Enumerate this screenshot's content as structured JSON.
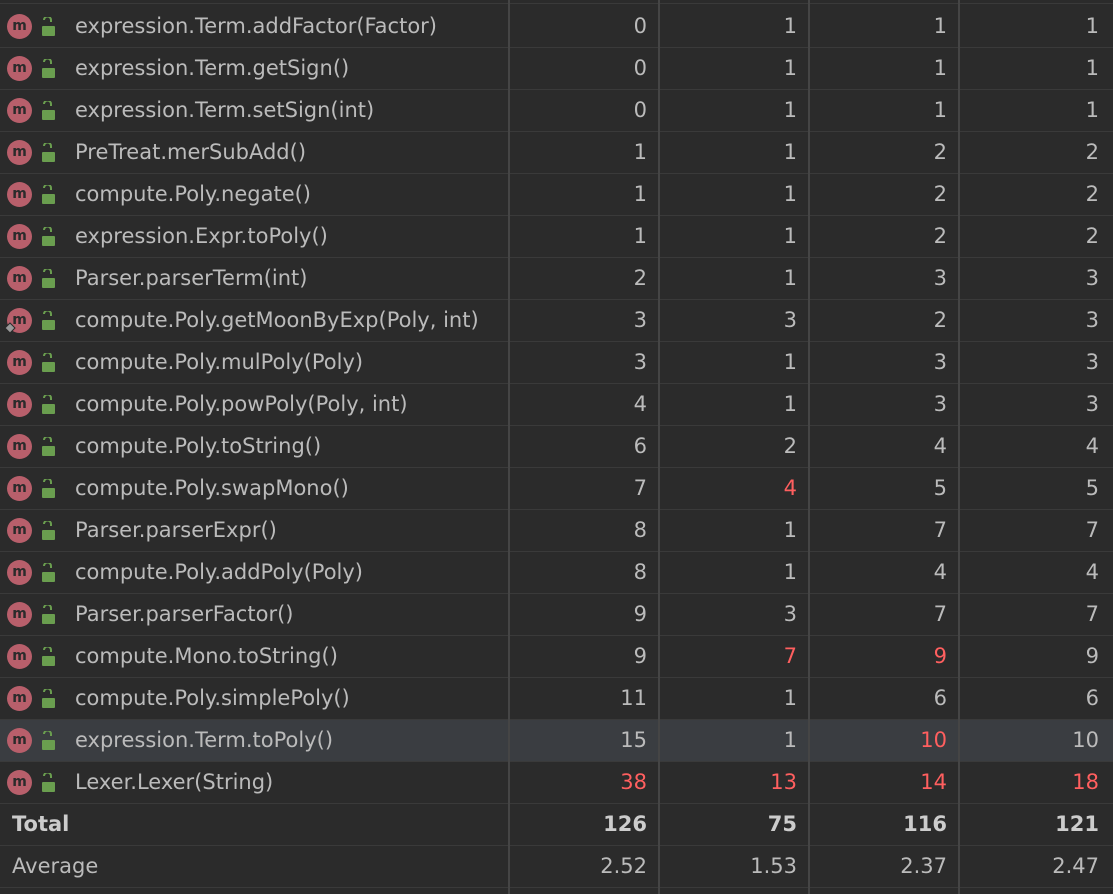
{
  "rows": [
    {
      "name": "expression.Term.addFactor(Factor)",
      "v": [
        "0",
        "1",
        "1",
        "1"
      ],
      "hot": [
        false,
        false,
        false,
        false
      ]
    },
    {
      "name": "expression.Term.getSign()",
      "v": [
        "0",
        "1",
        "1",
        "1"
      ],
      "hot": [
        false,
        false,
        false,
        false
      ]
    },
    {
      "name": "expression.Term.setSign(int)",
      "v": [
        "0",
        "1",
        "1",
        "1"
      ],
      "hot": [
        false,
        false,
        false,
        false
      ]
    },
    {
      "name": "PreTreat.merSubAdd()",
      "v": [
        "1",
        "1",
        "2",
        "2"
      ],
      "hot": [
        false,
        false,
        false,
        false
      ]
    },
    {
      "name": "compute.Poly.negate()",
      "v": [
        "1",
        "1",
        "2",
        "2"
      ],
      "hot": [
        false,
        false,
        false,
        false
      ]
    },
    {
      "name": "expression.Expr.toPoly()",
      "v": [
        "1",
        "1",
        "2",
        "2"
      ],
      "hot": [
        false,
        false,
        false,
        false
      ]
    },
    {
      "name": "Parser.parserTerm(int)",
      "v": [
        "2",
        "1",
        "3",
        "3"
      ],
      "hot": [
        false,
        false,
        false,
        false
      ]
    },
    {
      "name": "compute.Poly.getMoonByExp(Poly, int)",
      "v": [
        "3",
        "3",
        "2",
        "3"
      ],
      "hot": [
        false,
        false,
        false,
        false
      ],
      "override": true
    },
    {
      "name": "compute.Poly.mulPoly(Poly)",
      "v": [
        "3",
        "1",
        "3",
        "3"
      ],
      "hot": [
        false,
        false,
        false,
        false
      ]
    },
    {
      "name": "compute.Poly.powPoly(Poly, int)",
      "v": [
        "4",
        "1",
        "3",
        "3"
      ],
      "hot": [
        false,
        false,
        false,
        false
      ]
    },
    {
      "name": "compute.Poly.toString()",
      "v": [
        "6",
        "2",
        "4",
        "4"
      ],
      "hot": [
        false,
        false,
        false,
        false
      ]
    },
    {
      "name": "compute.Poly.swapMono()",
      "v": [
        "7",
        "4",
        "5",
        "5"
      ],
      "hot": [
        false,
        true,
        false,
        false
      ]
    },
    {
      "name": "Parser.parserExpr()",
      "v": [
        "8",
        "1",
        "7",
        "7"
      ],
      "hot": [
        false,
        false,
        false,
        false
      ]
    },
    {
      "name": "compute.Poly.addPoly(Poly)",
      "v": [
        "8",
        "1",
        "4",
        "4"
      ],
      "hot": [
        false,
        false,
        false,
        false
      ]
    },
    {
      "name": "Parser.parserFactor()",
      "v": [
        "9",
        "3",
        "7",
        "7"
      ],
      "hot": [
        false,
        false,
        false,
        false
      ]
    },
    {
      "name": "compute.Mono.toString()",
      "v": [
        "9",
        "7",
        "9",
        "9"
      ],
      "hot": [
        false,
        true,
        true,
        false
      ]
    },
    {
      "name": "compute.Poly.simplePoly()",
      "v": [
        "11",
        "1",
        "6",
        "6"
      ],
      "hot": [
        false,
        false,
        false,
        false
      ]
    },
    {
      "name": "expression.Term.toPoly()",
      "v": [
        "15",
        "1",
        "10",
        "10"
      ],
      "hot": [
        false,
        false,
        true,
        false
      ],
      "selected": true
    },
    {
      "name": "Lexer.Lexer(String)",
      "v": [
        "38",
        "13",
        "14",
        "18"
      ],
      "hot": [
        true,
        true,
        true,
        true
      ]
    }
  ],
  "total": {
    "label": "Total",
    "v": [
      "126",
      "75",
      "116",
      "121"
    ]
  },
  "average": {
    "label": "Average",
    "v": [
      "2.52",
      "1.53",
      "2.37",
      "2.47"
    ]
  },
  "icons": {
    "method": "method-icon",
    "access": "public-unlock-icon",
    "override": "override-marker-icon"
  },
  "method_icon_letter": "m",
  "colors": {
    "background": "#2b2b2b",
    "text": "#bbbbbb",
    "hot": "#ff5f5f",
    "method_icon": "#b85f6b",
    "lock_icon": "#6a9e4f",
    "selected_row": "#3a3d41"
  }
}
